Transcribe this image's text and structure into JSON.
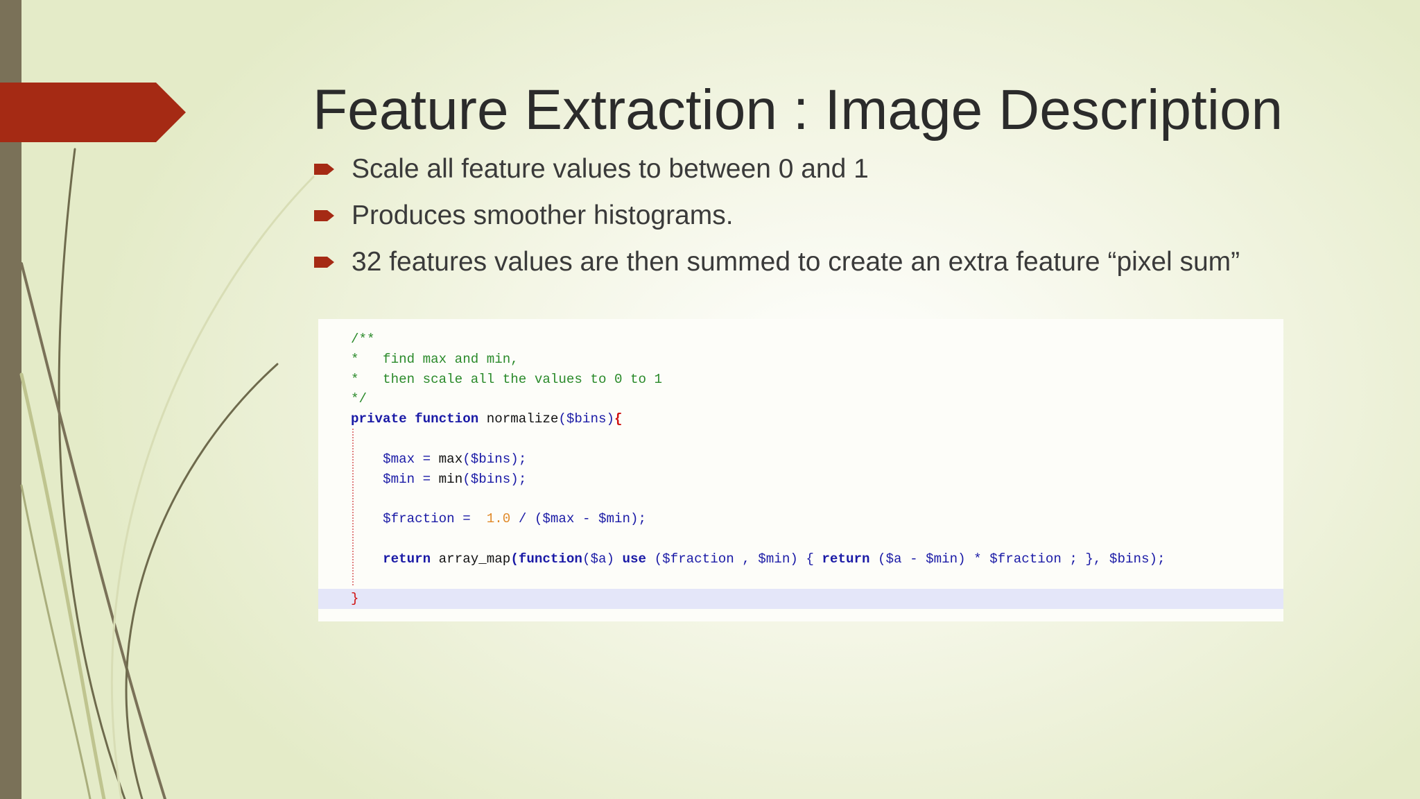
{
  "slide": {
    "title": "Feature Extraction :  Image Description",
    "bullets": [
      "Scale all feature values to between 0 and 1",
      "Produces smoother histograms.",
      "32 features values are then summed to create an extra feature “pixel sum”"
    ]
  },
  "code": {
    "lines": {
      "l1": "/**",
      "l2": "*   find max and min,",
      "l3": "*   then scale all the values to 0 to 1",
      "l4": "*/",
      "l5_kw": "private function ",
      "l5_fn": "normalize",
      "l5_args": "($bins)",
      "l5_brace": "{",
      "l7_var": "$max",
      "l7_op": " = ",
      "l7_fn": "max",
      "l7_args": "($bins);",
      "l8_var": "$min",
      "l8_op": " = ",
      "l8_fn": "min",
      "l8_args": "($bins);",
      "l10_var": "$fraction",
      "l10_op": " =  ",
      "l10_num": "1.0",
      "l10_rest": " / ($max - $min);",
      "l12_kw1": "return ",
      "l12_fn": "array_map",
      "l12_kw2": "(function",
      "l12_a": "($a) ",
      "l12_kw3": "use",
      "l12_b": " ($fraction , $min) { ",
      "l12_kw4": "return",
      "l12_c": " ($a - $min) * $fraction ; }, $bins);",
      "l14": "}"
    }
  },
  "colors": {
    "accent_red": "#a52a14",
    "side_bar": "#7a7158",
    "title_text": "#2b2b2b"
  }
}
